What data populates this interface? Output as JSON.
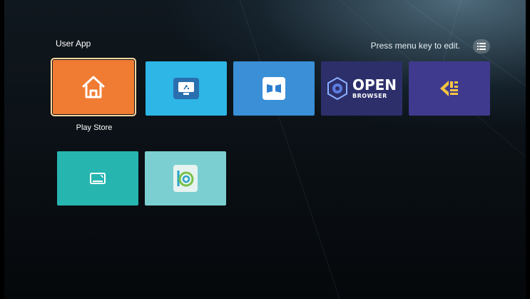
{
  "section": {
    "title": "User App"
  },
  "header": {
    "hint": "Press menu key to edit.",
    "menu_icon": "list-icon"
  },
  "apps": [
    {
      "label": "Play Store",
      "icon": "home-icon",
      "color": "#f07b32",
      "focused": true
    },
    {
      "label": "",
      "icon": "monitor-cursor-icon",
      "color": "#2db6e6"
    },
    {
      "label": "",
      "icon": "split-screen-icon",
      "color": "#3a8fd6"
    },
    {
      "label": "",
      "icon": "open-browser-logo",
      "color": "#2d2f6b",
      "logo_text": [
        "OPEN",
        "BROWSER"
      ]
    },
    {
      "label": "",
      "icon": "anisi-logo",
      "color": "#403a8e"
    },
    {
      "label": "",
      "icon": "cast-icon",
      "color": "#27b5b0"
    },
    {
      "label": "",
      "icon": "wave-app-icon",
      "color": "#7ccfd0"
    }
  ],
  "colors": {
    "accent_focus": "#ffd9a0",
    "background": "#0b1116"
  }
}
